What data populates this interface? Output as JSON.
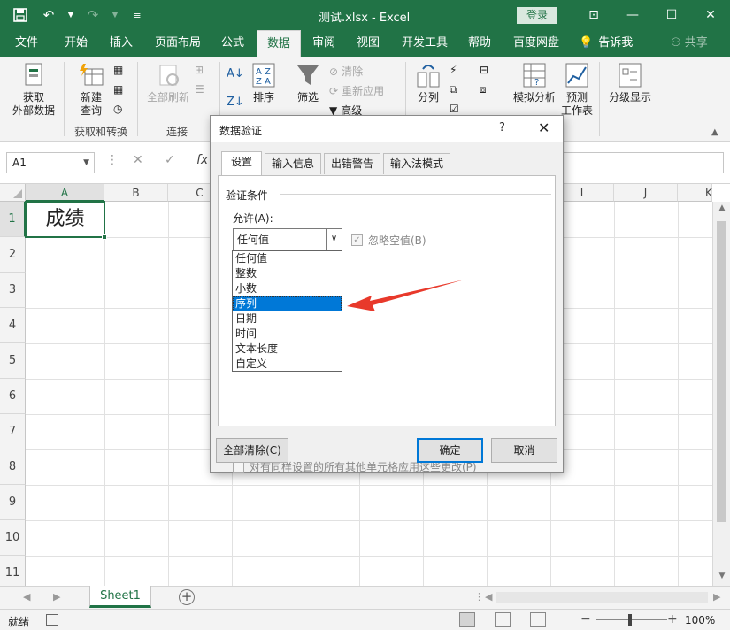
{
  "window": {
    "title": "测试.xlsx  -  Excel",
    "login": "登录"
  },
  "qat": {
    "save_icon": "save-icon",
    "undo_icon": "undo-icon",
    "redo_icon": "redo-icon",
    "customize_icon": "customize-icon"
  },
  "tabs": [
    "文件",
    "开始",
    "插入",
    "页面布局",
    "公式",
    "数据",
    "审阅",
    "视图",
    "开发工具",
    "帮助",
    "百度网盘"
  ],
  "tellme": "告诉我",
  "share": "共享",
  "ribbon": {
    "get_data": [
      "获取",
      "外部数据"
    ],
    "new_query": [
      "新建",
      "查询"
    ],
    "group_get_transform": "获取和转换",
    "refresh_all": "全部刷新",
    "group_connect": "连接",
    "sort": "排序",
    "filter": "筛选",
    "clear": "清除",
    "reapply": "重新应用",
    "advanced": "高级",
    "split": "分列",
    "whatif": "模拟分析",
    "forecast": [
      "预测",
      "工作表"
    ],
    "outline": "分级显示"
  },
  "formula_bar": {
    "namebox": "A1",
    "fx": "fx"
  },
  "grid": {
    "columns": [
      "A",
      "B",
      "C",
      "D",
      "E",
      "F",
      "G",
      "H",
      "I",
      "J",
      "K"
    ],
    "rows": [
      "1",
      "2",
      "3",
      "4",
      "5",
      "6",
      "7",
      "8",
      "9",
      "10",
      "11"
    ],
    "a1_value": "成绩"
  },
  "sheet": {
    "tab": "Sheet1",
    "add": "+"
  },
  "status": {
    "text": "就绪",
    "zoom": "100%"
  },
  "dialog": {
    "title": "数据验证",
    "help": "?",
    "tabs": [
      "设置",
      "输入信息",
      "出错警告",
      "输入法模式"
    ],
    "section": "验证条件",
    "allow_label": "允许(A):",
    "allow_value": "任何值",
    "ignore_blank": "忽略空值(B)",
    "apply_all": "对有同样设置的所有其他单元格应用这些更改(P)",
    "clear_all": "全部清除(C)",
    "ok": "确定",
    "cancel": "取消",
    "options": [
      "任何值",
      "整数",
      "小数",
      "序列",
      "日期",
      "时间",
      "文本长度",
      "自定义"
    ],
    "selected_option": "序列"
  },
  "colors": {
    "excel_green": "#217346",
    "select_blue": "#0078d7",
    "arrow_red": "#e8392b"
  }
}
